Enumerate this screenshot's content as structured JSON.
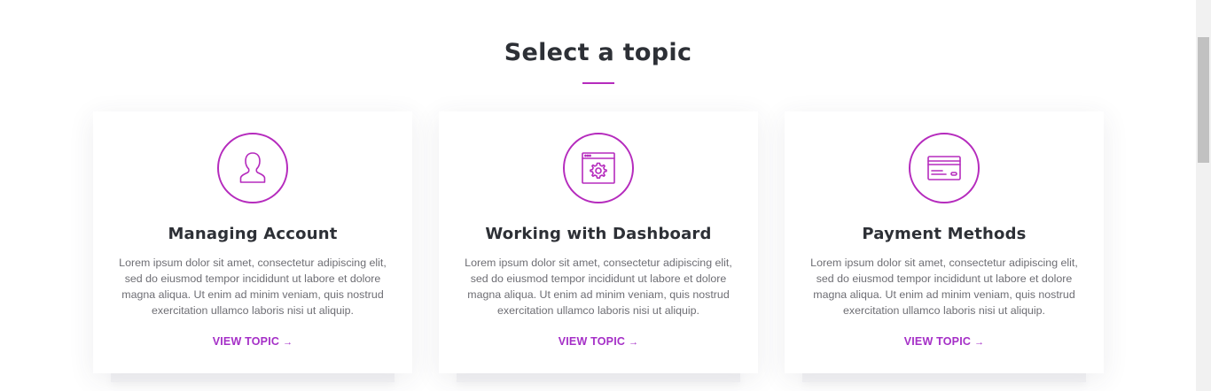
{
  "section": {
    "title": "Select a topic",
    "accent_color": "#b52bbd"
  },
  "cards": [
    {
      "icon": "user-icon",
      "title": "Managing Account",
      "text": "Lorem ipsum dolor sit amet, consectetur adipiscing elit, sed do eiusmod tempor incididunt ut labore et dolore magna aliqua. Ut enim ad minim veniam, quis nostrud exercitation ullamco laboris nisi ut aliquip.",
      "link_label": "VIEW TOPIC",
      "link_arrow": "→"
    },
    {
      "icon": "dashboard-settings-icon",
      "title": "Working with Dashboard",
      "text": "Lorem ipsum dolor sit amet, consectetur adipiscing elit, sed do eiusmod tempor incididunt ut labore et dolore magna aliqua. Ut enim ad minim veniam, quis nostrud exercitation ullamco laboris nisi ut aliquip.",
      "link_label": "VIEW TOPIC",
      "link_arrow": "→"
    },
    {
      "icon": "credit-card-icon",
      "title": "Payment Methods",
      "text": "Lorem ipsum dolor sit amet, consectetur adipiscing elit, sed do eiusmod tempor incididunt ut labore et dolore magna aliqua. Ut enim ad minim veniam, quis nostrud exercitation ullamco laboris nisi ut aliquip.",
      "link_label": "VIEW TOPIC",
      "link_arrow": "→"
    }
  ]
}
